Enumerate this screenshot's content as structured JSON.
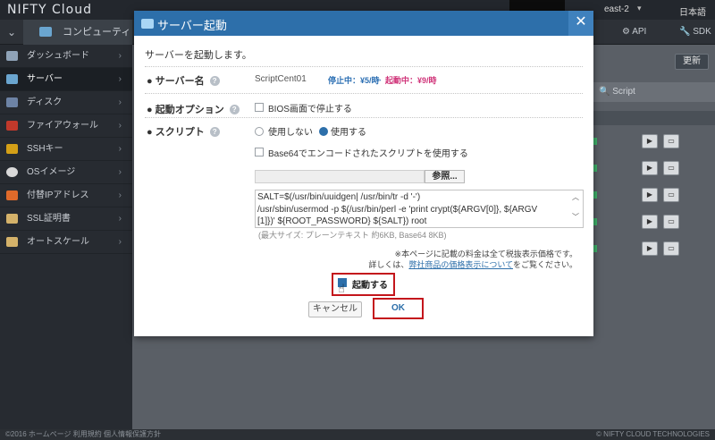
{
  "app": {
    "brand": "NIFTY Cloud",
    "region": "east-2",
    "language": "日本語"
  },
  "nav": {
    "compute_label": "コンピューティング",
    "api_label": "API",
    "sdk_label": "SDK"
  },
  "sidebar": {
    "items": [
      {
        "label": "ダッシュボード",
        "icon": "dashboard-icon",
        "color": "#8fa3b8"
      },
      {
        "label": "サーバー",
        "icon": "server-icon",
        "color": "#6aa5cf"
      },
      {
        "label": "ディスク",
        "icon": "disk-icon",
        "color": "#6d83a5"
      },
      {
        "label": "ファイアウォール",
        "icon": "firewall-icon",
        "color": "#c0392b"
      },
      {
        "label": "SSHキー",
        "icon": "key-icon",
        "color": "#d4a017"
      },
      {
        "label": "OSイメージ",
        "icon": "os-image-icon",
        "color": "#d9d9d9"
      },
      {
        "label": "付替IPアドレス",
        "icon": "ip-address-icon",
        "color": "#e06a2a"
      },
      {
        "label": "SSL証明書",
        "icon": "certificate-icon",
        "color": "#d4b26a"
      },
      {
        "label": "オートスケール",
        "icon": "autoscale-icon",
        "color": "#d4b26a"
      }
    ]
  },
  "main": {
    "refresh_label": "更新",
    "search_placeholder": "Script"
  },
  "modal": {
    "title": "サーバー起動",
    "intro": "サーバーを起動します。",
    "server_name_label": "サーバー名",
    "server_name": "ScriptCent01",
    "price_stopped": "停止中：¥5/時",
    "price_arrow": "→",
    "price_running": "起動中：¥9/時",
    "boot_option_label": "起動オプション",
    "bios_label": "BIOS画面で停止する",
    "script_label": "スクリプト",
    "script_no_label": "使用しない",
    "script_yes_label": "使用する",
    "script_selected": "使用する",
    "base64_label": "Base64でエンコードされたスクリプトを使用する",
    "browse_label": "参照...",
    "script_text": "SALT=$(/usr/bin/uuidgen| /usr/bin/tr -d '-')\n/usr/sbin/usermod -p $(/usr/bin/perl -e 'print crypt(${ARGV[0]}, ${ARGV\n[1]})' ${ROOT_PASSWORD} ${SALT}) root",
    "script_hint": "(最大サイズ: プレーンテキスト 約6KB, Base64 8KB)",
    "note_line1": "※本ページに記載の料金は全て税抜表示価格です。",
    "note_line2_prefix": "詳しくは、",
    "note_link": "弊社商品の価格表示について",
    "note_line2_suffix": "をご覧ください。",
    "start_label": "起動する",
    "cancel_label": "キャンセル",
    "ok_label": "OK",
    "accent_color": "#2d6faa",
    "highlight_color": "#c4161c"
  },
  "footer": {
    "left_text": "©2016 ホームページ 利用規約 個人情報保護方針",
    "right_text": "© NIFTY CLOUD TECHNOLOGIES"
  }
}
